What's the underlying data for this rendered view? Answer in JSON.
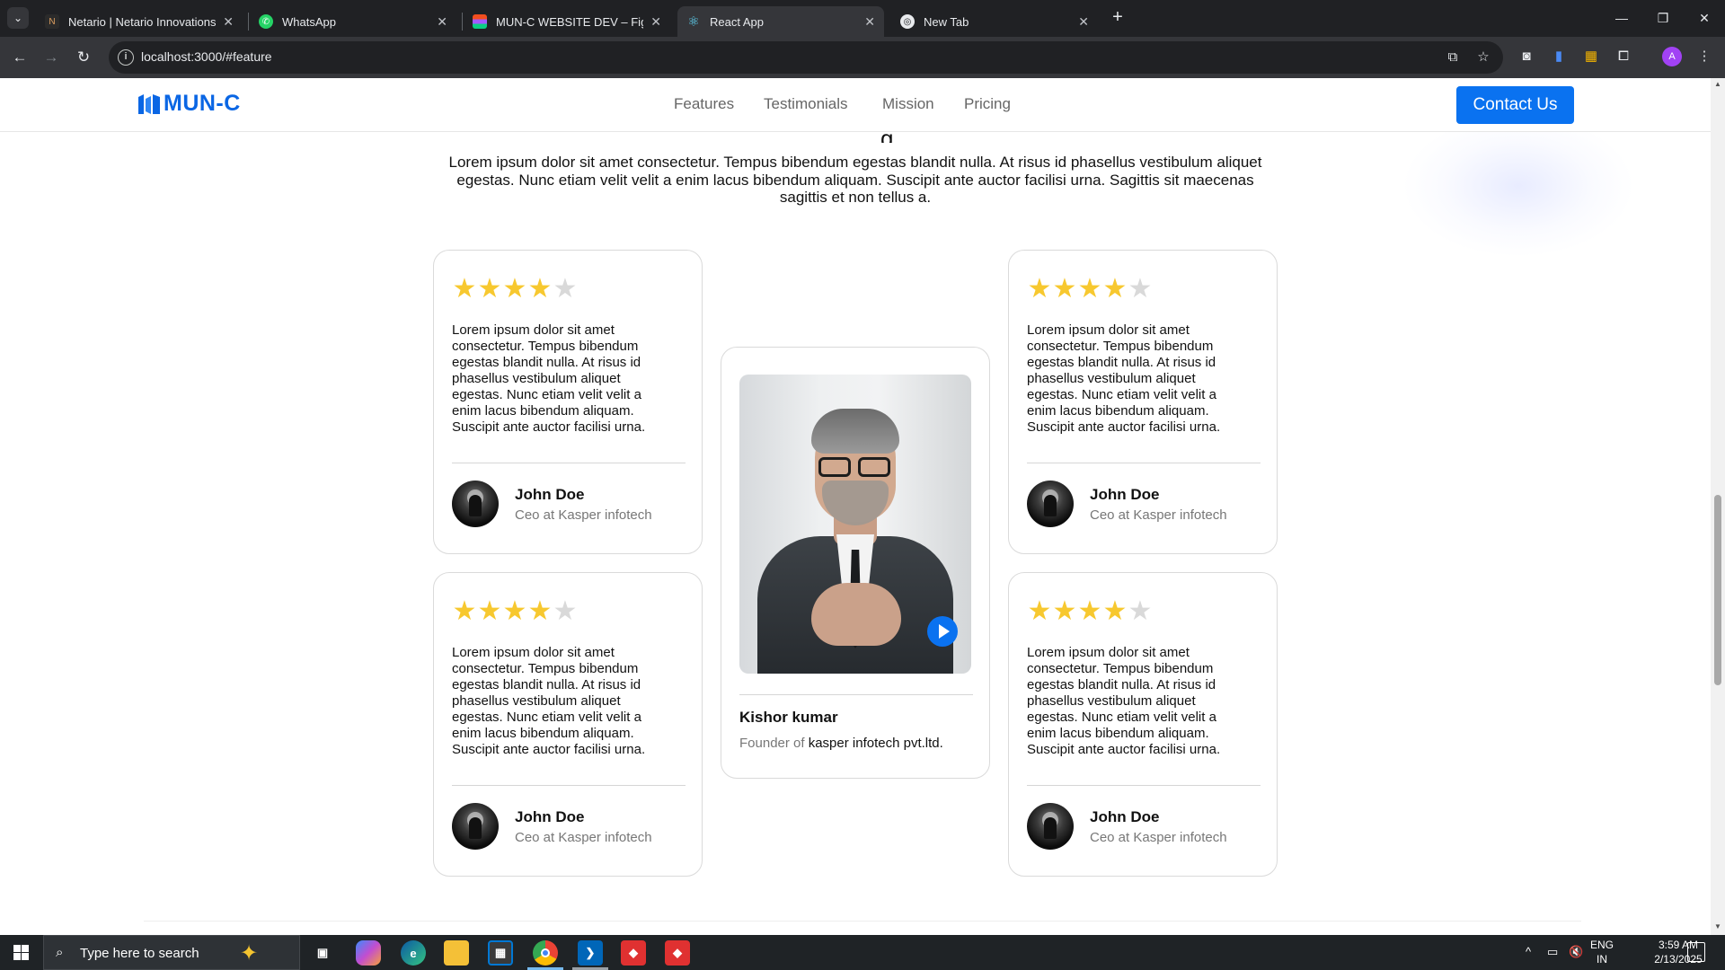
{
  "browser": {
    "tabs": [
      {
        "title": "Netario | Netario Innovations P",
        "icon": "netario-icon",
        "active": false
      },
      {
        "title": "WhatsApp",
        "icon": "whatsapp-icon",
        "active": false
      },
      {
        "title": "MUN-C WEBSITE DEV – Figma",
        "icon": "figma-icon",
        "active": false
      },
      {
        "title": "React App",
        "icon": "react-icon",
        "active": true
      },
      {
        "title": "New Tab",
        "icon": "chrome-icon",
        "active": false
      }
    ],
    "url": "localhost:3000/#feature",
    "profile_initial": "A"
  },
  "site": {
    "logo_text": "MUN-C",
    "nav": [
      "Features",
      "Testimonials",
      "Mission",
      "Pricing"
    ],
    "contact_label": "Contact Us",
    "brand_color": "#0a72f0"
  },
  "testimonials": {
    "intro": "Lorem ipsum dolor sit amet consectetur. Tempus bibendum egestas blandit nulla. At risus id phasellus vestibulum aliquet egestas. Nunc etiam velit velit a enim lacus bibendum aliquam. Suscipit ante auctor facilisi urna. Sagittis sit maecenas sagittis et non tellus a.",
    "reviews": [
      {
        "rating": 4,
        "max": 5,
        "text": "Lorem ipsum dolor sit amet consectetur. Tempus bibendum egestas blandit nulla. At risus id phasellus vestibulum aliquet egestas. Nunc etiam velit velit a enim lacus bibendum aliquam. Suscipit ante auctor facilisi urna.",
        "name": "John Doe",
        "role": "Ceo at Kasper infotech"
      },
      {
        "rating": 4,
        "max": 5,
        "text": "Lorem ipsum dolor sit amet consectetur. Tempus bibendum egestas blandit nulla. At risus id phasellus vestibulum aliquet egestas. Nunc etiam velit velit a enim lacus bibendum aliquam. Suscipit ante auctor facilisi urna.",
        "name": "John Doe",
        "role": "Ceo at Kasper infotech"
      },
      {
        "rating": 4,
        "max": 5,
        "text": "Lorem ipsum dolor sit amet consectetur. Tempus bibendum egestas blandit nulla. At risus id phasellus vestibulum aliquet egestas. Nunc etiam velit velit a enim lacus bibendum aliquam. Suscipit ante auctor facilisi urna.",
        "name": "John Doe",
        "role": "Ceo at Kasper infotech"
      },
      {
        "rating": 4,
        "max": 5,
        "text": "Lorem ipsum dolor sit amet consectetur. Tempus bibendum egestas blandit nulla. At risus id phasellus vestibulum aliquet egestas. Nunc etiam velit velit a enim lacus bibendum aliquam. Suscipit ante auctor facilisi urna.",
        "name": "John Doe",
        "role": "Ceo at Kasper infotech"
      }
    ],
    "video": {
      "name": "Kishor kumar",
      "role_prefix": "Founder of",
      "company": "kasper infotech pvt.ltd."
    },
    "star_color": "#f7c82f"
  },
  "taskbar": {
    "search_placeholder": "Type here to search",
    "lang_top": "ENG",
    "lang_bottom": "IN",
    "time": "3:59 AM",
    "date": "2/13/2025"
  }
}
